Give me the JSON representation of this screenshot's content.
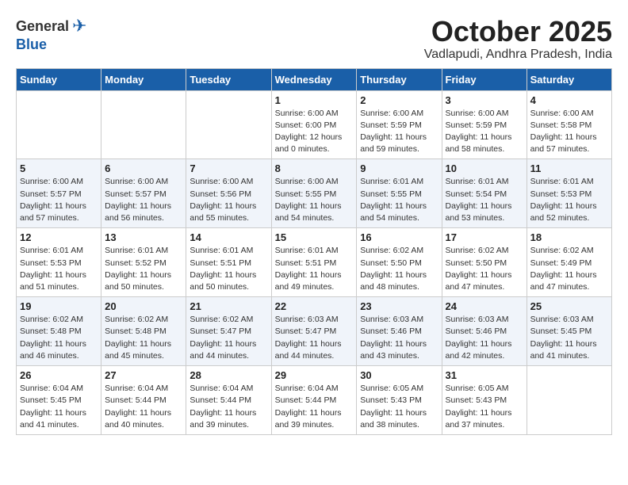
{
  "logo": {
    "general": "General",
    "blue": "Blue"
  },
  "header": {
    "month": "October 2025",
    "location": "Vadlapudi, Andhra Pradesh, India"
  },
  "weekdays": [
    "Sunday",
    "Monday",
    "Tuesday",
    "Wednesday",
    "Thursday",
    "Friday",
    "Saturday"
  ],
  "weeks": [
    [
      {
        "day": "",
        "info": ""
      },
      {
        "day": "",
        "info": ""
      },
      {
        "day": "",
        "info": ""
      },
      {
        "day": "1",
        "info": "Sunrise: 6:00 AM\nSunset: 6:00 PM\nDaylight: 12 hours\nand 0 minutes."
      },
      {
        "day": "2",
        "info": "Sunrise: 6:00 AM\nSunset: 5:59 PM\nDaylight: 11 hours\nand 59 minutes."
      },
      {
        "day": "3",
        "info": "Sunrise: 6:00 AM\nSunset: 5:59 PM\nDaylight: 11 hours\nand 58 minutes."
      },
      {
        "day": "4",
        "info": "Sunrise: 6:00 AM\nSunset: 5:58 PM\nDaylight: 11 hours\nand 57 minutes."
      }
    ],
    [
      {
        "day": "5",
        "info": "Sunrise: 6:00 AM\nSunset: 5:57 PM\nDaylight: 11 hours\nand 57 minutes."
      },
      {
        "day": "6",
        "info": "Sunrise: 6:00 AM\nSunset: 5:57 PM\nDaylight: 11 hours\nand 56 minutes."
      },
      {
        "day": "7",
        "info": "Sunrise: 6:00 AM\nSunset: 5:56 PM\nDaylight: 11 hours\nand 55 minutes."
      },
      {
        "day": "8",
        "info": "Sunrise: 6:00 AM\nSunset: 5:55 PM\nDaylight: 11 hours\nand 54 minutes."
      },
      {
        "day": "9",
        "info": "Sunrise: 6:01 AM\nSunset: 5:55 PM\nDaylight: 11 hours\nand 54 minutes."
      },
      {
        "day": "10",
        "info": "Sunrise: 6:01 AM\nSunset: 5:54 PM\nDaylight: 11 hours\nand 53 minutes."
      },
      {
        "day": "11",
        "info": "Sunrise: 6:01 AM\nSunset: 5:53 PM\nDaylight: 11 hours\nand 52 minutes."
      }
    ],
    [
      {
        "day": "12",
        "info": "Sunrise: 6:01 AM\nSunset: 5:53 PM\nDaylight: 11 hours\nand 51 minutes."
      },
      {
        "day": "13",
        "info": "Sunrise: 6:01 AM\nSunset: 5:52 PM\nDaylight: 11 hours\nand 50 minutes."
      },
      {
        "day": "14",
        "info": "Sunrise: 6:01 AM\nSunset: 5:51 PM\nDaylight: 11 hours\nand 50 minutes."
      },
      {
        "day": "15",
        "info": "Sunrise: 6:01 AM\nSunset: 5:51 PM\nDaylight: 11 hours\nand 49 minutes."
      },
      {
        "day": "16",
        "info": "Sunrise: 6:02 AM\nSunset: 5:50 PM\nDaylight: 11 hours\nand 48 minutes."
      },
      {
        "day": "17",
        "info": "Sunrise: 6:02 AM\nSunset: 5:50 PM\nDaylight: 11 hours\nand 47 minutes."
      },
      {
        "day": "18",
        "info": "Sunrise: 6:02 AM\nSunset: 5:49 PM\nDaylight: 11 hours\nand 47 minutes."
      }
    ],
    [
      {
        "day": "19",
        "info": "Sunrise: 6:02 AM\nSunset: 5:48 PM\nDaylight: 11 hours\nand 46 minutes."
      },
      {
        "day": "20",
        "info": "Sunrise: 6:02 AM\nSunset: 5:48 PM\nDaylight: 11 hours\nand 45 minutes."
      },
      {
        "day": "21",
        "info": "Sunrise: 6:02 AM\nSunset: 5:47 PM\nDaylight: 11 hours\nand 44 minutes."
      },
      {
        "day": "22",
        "info": "Sunrise: 6:03 AM\nSunset: 5:47 PM\nDaylight: 11 hours\nand 44 minutes."
      },
      {
        "day": "23",
        "info": "Sunrise: 6:03 AM\nSunset: 5:46 PM\nDaylight: 11 hours\nand 43 minutes."
      },
      {
        "day": "24",
        "info": "Sunrise: 6:03 AM\nSunset: 5:46 PM\nDaylight: 11 hours\nand 42 minutes."
      },
      {
        "day": "25",
        "info": "Sunrise: 6:03 AM\nSunset: 5:45 PM\nDaylight: 11 hours\nand 41 minutes."
      }
    ],
    [
      {
        "day": "26",
        "info": "Sunrise: 6:04 AM\nSunset: 5:45 PM\nDaylight: 11 hours\nand 41 minutes."
      },
      {
        "day": "27",
        "info": "Sunrise: 6:04 AM\nSunset: 5:44 PM\nDaylight: 11 hours\nand 40 minutes."
      },
      {
        "day": "28",
        "info": "Sunrise: 6:04 AM\nSunset: 5:44 PM\nDaylight: 11 hours\nand 39 minutes."
      },
      {
        "day": "29",
        "info": "Sunrise: 6:04 AM\nSunset: 5:44 PM\nDaylight: 11 hours\nand 39 minutes."
      },
      {
        "day": "30",
        "info": "Sunrise: 6:05 AM\nSunset: 5:43 PM\nDaylight: 11 hours\nand 38 minutes."
      },
      {
        "day": "31",
        "info": "Sunrise: 6:05 AM\nSunset: 5:43 PM\nDaylight: 11 hours\nand 37 minutes."
      },
      {
        "day": "",
        "info": ""
      }
    ]
  ]
}
